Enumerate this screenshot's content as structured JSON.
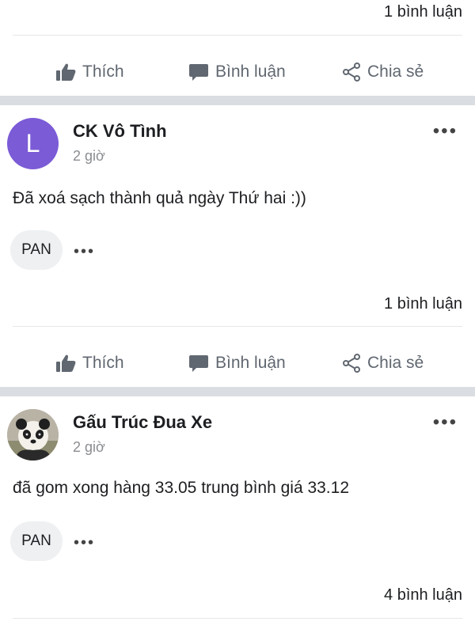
{
  "top": {
    "comments_count": "1 bình luận"
  },
  "actions": {
    "like": "Thích",
    "comment": "Bình luận",
    "share": "Chia sẻ"
  },
  "posts": [
    {
      "avatar_letter": "L",
      "avatar_color": "#7b5bd6",
      "author": "CK Vô Tình",
      "time": "2 giờ",
      "text": "Đã xoá sạch thành quả ngày Thứ hai :))",
      "tag": "PAN",
      "comments_count": "1 bình luận"
    },
    {
      "avatar_image": "panda-photo",
      "author": "Gấu Trúc Đua Xe",
      "time": "2 giờ",
      "text": "đã gom xong hàng 33.05 trung bình giá 33.12",
      "tag": "PAN",
      "comments_count": "4 bình luận"
    }
  ],
  "icons": {
    "like": "thumbs-up-icon",
    "comment": "speech-bubble-icon",
    "share": "share-icon",
    "more": "more-dots-icon"
  },
  "colors": {
    "action_gray": "#606770",
    "separator": "#dadde1",
    "tag_bg": "#eef0f2",
    "time_gray": "#8a8d91"
  }
}
